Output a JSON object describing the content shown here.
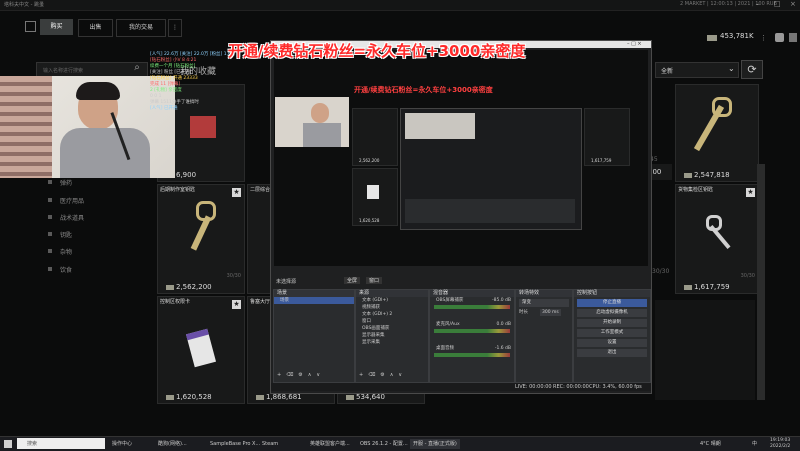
{
  "titlebar": {
    "title": "塔科夫中文 - 跳蚤",
    "status": "2 MARKET | 12:00:13 | 2021 | 100 RUB"
  },
  "nav": {
    "tabs": [
      "购买",
      "出售",
      "我的交易"
    ],
    "more": "⋮",
    "money": "453,781K"
  },
  "search": {
    "placeholder": "输入名称进行搜索"
  },
  "sort": {
    "selected": "全新"
  },
  "stream": {
    "banner": "开通/续费钻石粉丝=永久车位+3000亲密度",
    "banner_small": "开通/续费钻石粉丝=永久车位+3000亲密度"
  },
  "chat": [
    "[人气] 22.6万 [关注] 22.0万 [粉丝] 1.6万",
    "[钻石粉丝] 小V 8 4:21",
    "续费一个月 [钻石粉丝]",
    "[关注] 粉丝 [已开通]",
    "[钻石粉丝] 开通 23333",
    "完成 11 [弹幕]",
    "2 [礼物] 亲密度",
    "0 0 1",
    "弹幕 1511分手了谁搞时",
    "[人气] 已开通"
  ],
  "wishlist": "我的收藏",
  "categories": [
    "弹药",
    "医疗用品",
    "战术道具",
    "钥匙",
    "杂物",
    "饮食"
  ],
  "cards": [
    {
      "name": "",
      "price": "6,900",
      "qty": ""
    },
    {
      "name": "",
      "price": "2,547,818",
      "qty": ""
    },
    {
      "name": "后期制作室钥匙",
      "price": "2,562,200",
      "qty": "30/30"
    },
    {
      "name": "二层综合",
      "price": "",
      "qty": ""
    },
    {
      "name": "货物集检区钥匙",
      "price": "1,617,759",
      "qty": "30/30"
    },
    {
      "name": "控制区权限卡",
      "price": "1,620,528",
      "qty": ""
    },
    {
      "name": "鲁塞大厅",
      "price": "1,868,681",
      "qty": ""
    },
    {
      "name": "",
      "price": "534,640",
      "qty": ""
    }
  ],
  "side_numbers": {
    "a": "45",
    "b": "900",
    "c": "30/30",
    "d": "30/30"
  },
  "obs": {
    "preview_money": "2,562,200",
    "preview_money2": "1,620,528",
    "preview_money3": "1,617,759",
    "modes": [
      "全屏",
      "窗口"
    ],
    "scene_label": "未选择源",
    "scenes_header": "场景",
    "scenes": [
      "场景"
    ],
    "sources_header": "来源",
    "sources": [
      "文本 (GDI+)",
      "视频捕获",
      "文本 (GDI+) 2",
      "窗口",
      "OBS画面捕获",
      "显示器采集",
      "显示采集"
    ],
    "mixer_header": "混音器",
    "mixer": [
      {
        "name": "OBS屏幕捕获",
        "db": "-85.0 dB"
      },
      {
        "name": "麦克风/Aux",
        "db": "0.0 dB"
      },
      {
        "name": "桌面音频",
        "db": "-1.6 dB"
      }
    ],
    "transition_header": "转场特效",
    "transition": {
      "type": "渐变",
      "duration_label": "时长",
      "duration": "300 ms"
    },
    "controls_header": "控制按钮",
    "controls": [
      "停止直播",
      "启动虚拟摄像机",
      "开始录制",
      "工作室模式",
      "设置",
      "退出"
    ],
    "status": {
      "live": "LIVE: 00:00:00",
      "rec": "REC: 00:00:00",
      "cpu": "CPU: 3.4%, 60.00 fps"
    }
  },
  "taskbar": {
    "search": "搜索",
    "apps": [
      "操作中心",
      "酷狗(网络)...",
      "SampleBase Pro X...",
      "Steam",
      "英雄联盟客户端...",
      "OBS 26.1.2 - 配置...",
      "开服 - 直播(正式版)"
    ],
    "weather": "4°C 晴朗",
    "lang": "中",
    "time": "19:19:03",
    "date": "2022/2/2"
  }
}
